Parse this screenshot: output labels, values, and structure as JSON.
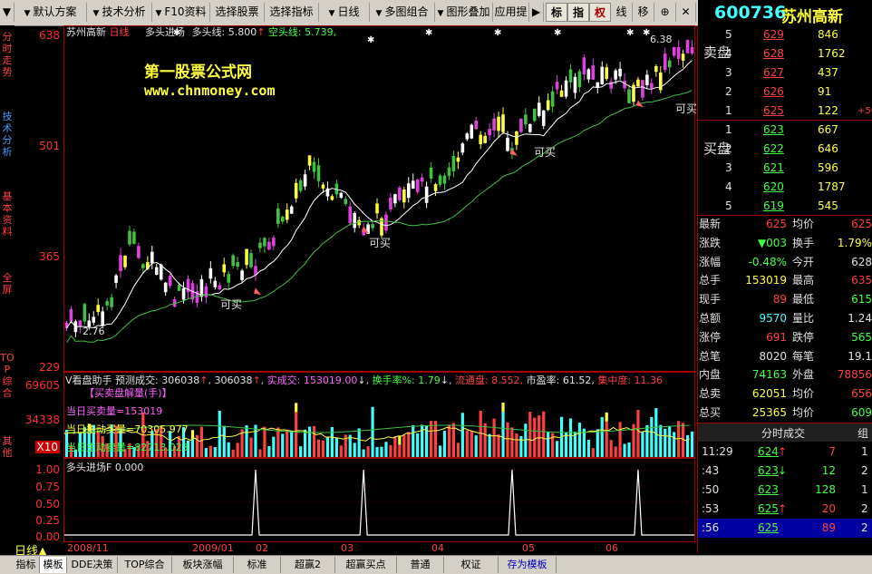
{
  "toolbar": {
    "items": [
      "默认方案",
      "技术分析",
      "F10资料",
      "选择股票",
      "选择指标",
      "日线",
      "多图组合",
      "图形叠加",
      "应用提"
    ],
    "toggles": [
      "标",
      "指",
      "权",
      "线",
      "移",
      "⊕"
    ]
  },
  "stock": {
    "code": "600736",
    "name": "苏州高新"
  },
  "left_tabs": [
    "分时走势",
    "技术分析",
    "基本资料",
    "全屏",
    "TOP综合",
    "其他"
  ],
  "main_chart": {
    "stock_label": "苏州高新",
    "period": "日线",
    "indicator_title": "多头进场",
    "bull_line_label": "多头线: 5.800",
    "bull_arrow": "↑",
    "bear_line_label": "空头线: 5.739,",
    "watermark_1": "第一股票公式网",
    "watermark_2": "www.chnmoney.com",
    "buy_label": "可买",
    "high_label": "6.38",
    "low_label": "2.76",
    "y_ticks": [
      "638",
      "501",
      "365",
      "229"
    ]
  },
  "volume_panel": {
    "title": "V看盘助手",
    "predict_label": "预测成交: 306038",
    "predict_arrow": "↑",
    "vol2": "306038",
    "vol2_arrow": "↑",
    "actual_label": "实成交: 153019.00",
    "actual_arrow": "↓",
    "turnover_label": "换手率%: 1.79",
    "turnover_arrow": "↓",
    "float_label": "流通盘: 8.552,",
    "pe_label": "市盈率: 61.52,",
    "conc_label": "集中度: 11.36",
    "subtitle": "【买卖盘解量(手)】",
    "today_buy": "当日买卖量=153019",
    "today_main": "当日主动买量=70305.977",
    "today_main2": "当日主动卖量=82713.023",
    "y_ticks": [
      "69605",
      "34338",
      "X10"
    ]
  },
  "signal_panel": {
    "title": "多头进场F",
    "value": "0.000",
    "y_ticks": [
      "1.00",
      "0.75",
      "0.50",
      "0.25",
      "0.00"
    ]
  },
  "x_axis": {
    "labels": [
      "2008/11",
      "2009/01",
      "02",
      "03",
      "04",
      "05",
      "06"
    ]
  },
  "period_label": "日线",
  "order_book": {
    "sell_label": "卖盘",
    "buy_label": "买盘",
    "sell": [
      {
        "lvl": "5",
        "price": "629",
        "vol": "846"
      },
      {
        "lvl": "4",
        "price": "628",
        "vol": "1762"
      },
      {
        "lvl": "3",
        "price": "627",
        "vol": "437"
      },
      {
        "lvl": "2",
        "price": "626",
        "vol": "91"
      },
      {
        "lvl": "1",
        "price": "625",
        "vol": "122",
        "extra": "+50"
      }
    ],
    "buy": [
      {
        "lvl": "1",
        "price": "623",
        "vol": "667"
      },
      {
        "lvl": "2",
        "price": "622",
        "vol": "646"
      },
      {
        "lvl": "3",
        "price": "621",
        "vol": "596"
      },
      {
        "lvl": "4",
        "price": "620",
        "vol": "1787"
      },
      {
        "lvl": "5",
        "price": "619",
        "vol": "545"
      }
    ]
  },
  "quote": [
    {
      "k1": "最新",
      "v1": "625",
      "k2": "均价",
      "v2": "625"
    },
    {
      "k1": "涨跌",
      "v1": "▼003",
      "k2": "换手",
      "v2": "1.79%"
    },
    {
      "k1": "涨幅",
      "v1": "-0.48%",
      "k2": "今开",
      "v2": "628"
    },
    {
      "k1": "总手",
      "v1": "153019",
      "k2": "最高",
      "v2": "635"
    },
    {
      "k1": "现手",
      "v1": "89",
      "k2": "最低",
      "v2": "615"
    },
    {
      "k1": "总额",
      "v1": "9570",
      "k2": "量比",
      "v2": "1.24"
    },
    {
      "k1": "涨停",
      "v1": "691",
      "k2": "跌停",
      "v2": "565"
    },
    {
      "k1": "总笔",
      "v1": "8020",
      "k2": "每笔",
      "v2": "19.1"
    },
    {
      "k1": "内盘",
      "v1": "74163",
      "k2": "外盘",
      "v2": "78856"
    },
    {
      "k1": "总卖",
      "v1": "62051",
      "k2": "均价",
      "v2": "656"
    },
    {
      "k1": "总买",
      "v1": "25365",
      "k2": "均价",
      "v2": "609"
    }
  ],
  "ticks": {
    "title": "分时成交",
    "tab": "组",
    "rows": [
      {
        "time": "11:29",
        "price": "624",
        "arrow": "↑",
        "vol": "7",
        "n": "1"
      },
      {
        "time": ":43",
        "price": "623",
        "arrow": "↓",
        "vol": "12",
        "n": "2"
      },
      {
        "time": ":50",
        "price": "623",
        "arrow": "",
        "vol": "128",
        "n": "1"
      },
      {
        "time": ":53",
        "price": "625",
        "arrow": "↑",
        "vol": "20",
        "n": "2"
      },
      {
        "time": ":56",
        "price": "625",
        "arrow": "",
        "vol": "89",
        "n": "2"
      }
    ]
  },
  "bottom_tabs": [
    "指标",
    "模板",
    "DDE决策",
    "TOP综合",
    "板块涨幅",
    "标准",
    "超赢2",
    "超赢买点",
    "普通",
    "权证",
    "存为模板"
  ],
  "chart_data": {
    "type": "line",
    "title": "多头进场F",
    "x": [
      0,
      1,
      2,
      3,
      4,
      5,
      6,
      7,
      8,
      9,
      10,
      11,
      12,
      13,
      14,
      15,
      16,
      17,
      18,
      19,
      20,
      21,
      22,
      23,
      24,
      25,
      26,
      27,
      28,
      29,
      30,
      31,
      32,
      33,
      34,
      35,
      36,
      37,
      38,
      39,
      40,
      41,
      42,
      43,
      44,
      45,
      46,
      47,
      48,
      49,
      50,
      51,
      52,
      53,
      54,
      55,
      56,
      57,
      58,
      59,
      60,
      61,
      62,
      63,
      64,
      65,
      66,
      67,
      68,
      69,
      70,
      71,
      72,
      73,
      74,
      75,
      76,
      77,
      78,
      79,
      80,
      81,
      82,
      83,
      84,
      85,
      86,
      87,
      88,
      89,
      90,
      91,
      92,
      93,
      94,
      95,
      96,
      97,
      98,
      99,
      100,
      101,
      102,
      103,
      104,
      105,
      106,
      107,
      108,
      109,
      110,
      111,
      112,
      113,
      114,
      115,
      116,
      117,
      118,
      119,
      120,
      121,
      122,
      123,
      124,
      125,
      126,
      127,
      128,
      129,
      130,
      131,
      132,
      133,
      134,
      135,
      136,
      137,
      138,
      139
    ],
    "ylim": [
      0,
      1
    ],
    "signal_indices": [
      42,
      66,
      99,
      127
    ]
  }
}
